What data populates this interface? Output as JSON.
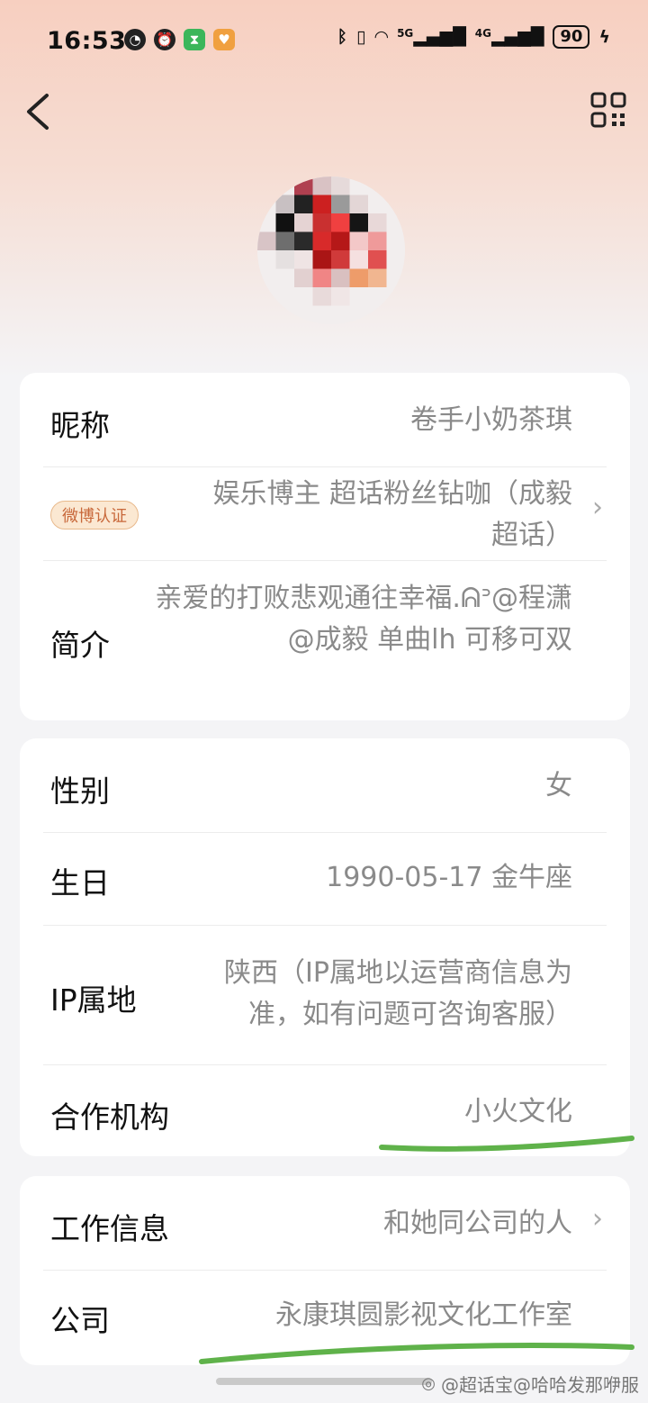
{
  "status_bar": {
    "time": "16:53",
    "battery": "90",
    "network_5g": "5G",
    "network_4g": "4G"
  },
  "profile": {
    "nickname_label": "昵称",
    "nickname_value": "卷手小奶茶琪",
    "verify_badge": "微博认证",
    "verify_value": "娱乐博主 超话粉丝钻咖（成毅超话）",
    "bio_label": "简介",
    "bio_value": "亲爱的打败悲观通往幸福.ᕱᐣ@程潇 @成毅  单曲lh 可移可双"
  },
  "info": {
    "gender_label": "性别",
    "gender_value": "女",
    "birthday_label": "生日",
    "birthday_value": "1990-05-17 金牛座",
    "ip_label": "IP属地",
    "ip_value": "陕西（IP属地以运营商信息为准，如有问题可咨询客服）",
    "org_label": "合作机构",
    "org_value": "小火文化"
  },
  "work": {
    "work_label": "工作信息",
    "work_value": "和她同公司的人",
    "company_label": "公司",
    "company_value": "永康琪圆影视文化工作室"
  },
  "watermark": "@超话宝@哈哈发那咿服",
  "colors": {
    "highlight_green": "#5fb24a",
    "badge_text": "#c8683a"
  }
}
